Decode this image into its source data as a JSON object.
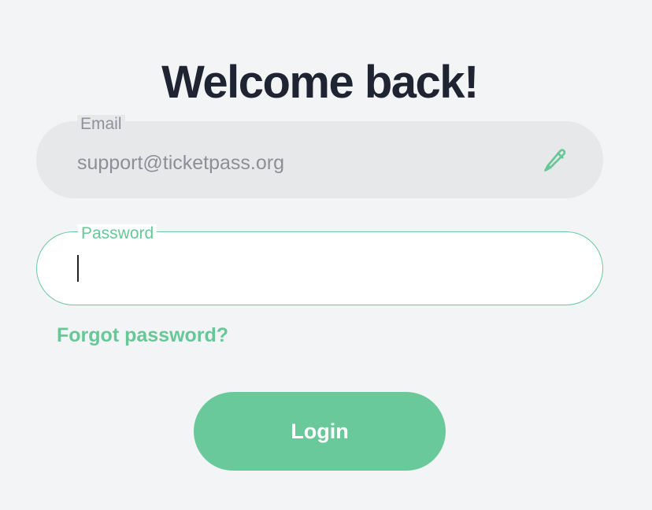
{
  "header": {
    "title": "Welcome back!"
  },
  "form": {
    "email": {
      "label": "Email",
      "value": "support@ticketpass.org",
      "action_icon": "pencil-edit-icon"
    },
    "password": {
      "label": "Password",
      "value": "",
      "focused": true
    },
    "forgot_link": "Forgot password?",
    "login_button": "Login"
  },
  "colors": {
    "accent": "#69c99b",
    "background": "#f3f4f6",
    "title": "#1f2433",
    "disabled_field": "#e7e8ea"
  }
}
